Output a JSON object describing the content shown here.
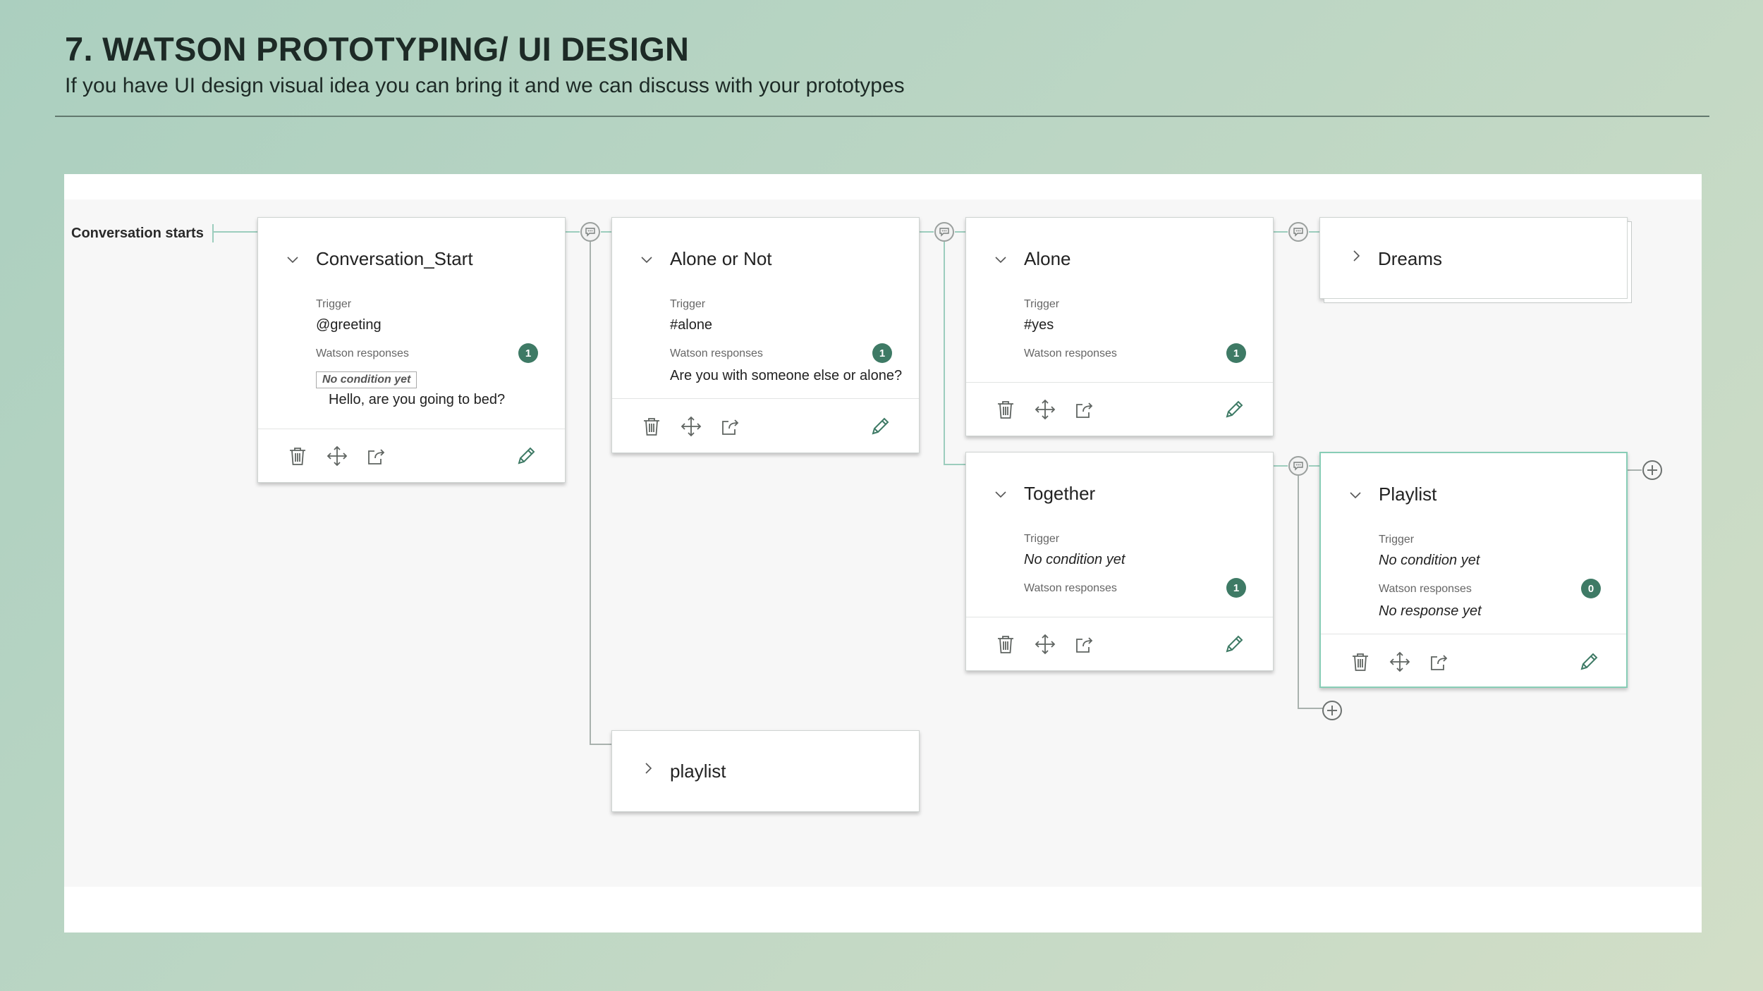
{
  "slide": {
    "title": "7. WATSON PROTOTYPING/ UI DESIGN",
    "subtitle": "If you have UI design visual idea you can bring it and we can discuss with your prototypes"
  },
  "editor": {
    "start_label": "Conversation starts",
    "labels": {
      "trigger": "Trigger",
      "responses": "Watson responses",
      "no_condition_tag": "No condition yet"
    },
    "nodes": {
      "conversation_start": {
        "title": "Conversation_Start",
        "trigger": "@greeting",
        "response_count": "1",
        "response_text": "Hello, are you going to bed?"
      },
      "alone_or_not": {
        "title": "Alone or Not",
        "trigger": "#alone",
        "response_count": "1",
        "response_text": "Are you with someone else or alone?"
      },
      "alone": {
        "title": "Alone",
        "trigger": "#yes",
        "response_count": "1"
      },
      "dreams": {
        "title": "Dreams"
      },
      "together": {
        "title": "Together",
        "trigger": "No condition yet",
        "response_count": "1"
      },
      "playlist_selected": {
        "title": "Playlist",
        "trigger": "No condition yet",
        "response_count": "0",
        "response_text": "No response yet"
      },
      "playlist_collapsed": {
        "title": "playlist"
      }
    },
    "icons": [
      "trash-icon",
      "move-icon",
      "jump-to-icon",
      "edit-pencil-icon",
      "chevron-down-icon",
      "chevron-right-icon",
      "speech-bubble-icon",
      "add-circle-icon"
    ],
    "colors": {
      "accent": "#3e7a65",
      "connector": "#9ccdbd",
      "selected_border": "#88cdb6"
    }
  }
}
